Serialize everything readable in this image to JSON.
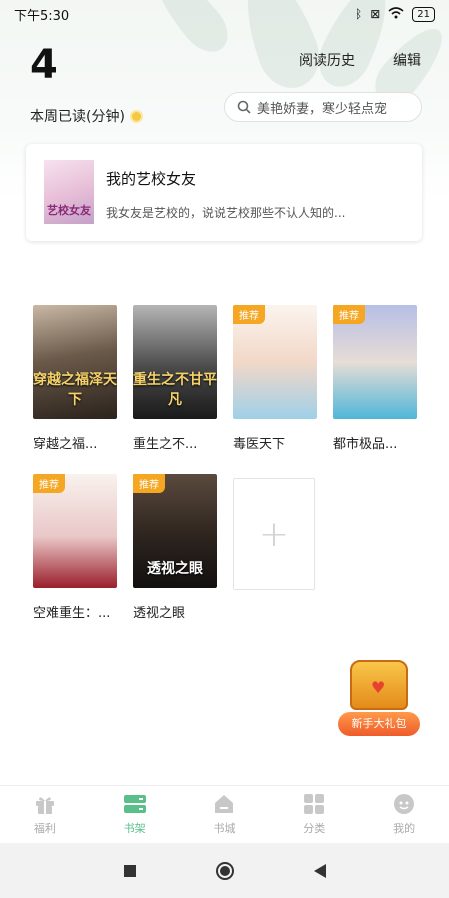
{
  "status_bar": {
    "time": "下午5:30",
    "battery": "21"
  },
  "header": {
    "minutes_read": "4",
    "week_label": "本周已读(分钟)",
    "history_label": "阅读历史",
    "edit_label": "编辑",
    "search_placeholder": "美艳娇妻，寒少轻点宠"
  },
  "recent": {
    "title": "我的艺校女友",
    "desc": "我女友是艺校的，说说艺校那些不认人知的...",
    "cover_text": "艺校女友"
  },
  "books": [
    {
      "name": "穿越之福...",
      "tag": "",
      "cover_text": "穿越之福泽天下"
    },
    {
      "name": "重生之不...",
      "tag": "",
      "cover_text": "重生之不甘平凡"
    },
    {
      "name": "毒医天下",
      "tag": "推荐",
      "cover_text": ""
    },
    {
      "name": "都市极品...",
      "tag": "推荐",
      "cover_text": ""
    },
    {
      "name": "空难重生：...",
      "tag": "推荐",
      "cover_text": ""
    },
    {
      "name": "透视之眼",
      "tag": "推荐",
      "cover_text": "透视之眼"
    }
  ],
  "gift_label": "新手大礼包",
  "nav": [
    {
      "label": "福利",
      "icon": "gift-icon"
    },
    {
      "label": "书架",
      "icon": "bookshelf-icon"
    },
    {
      "label": "书城",
      "icon": "bookstore-icon"
    },
    {
      "label": "分类",
      "icon": "category-icon"
    },
    {
      "label": "我的",
      "icon": "profile-icon"
    }
  ],
  "colors": {
    "accent": "#5ac08a",
    "tag": "#f5a623",
    "nav_inactive": "#aaaaaa"
  }
}
